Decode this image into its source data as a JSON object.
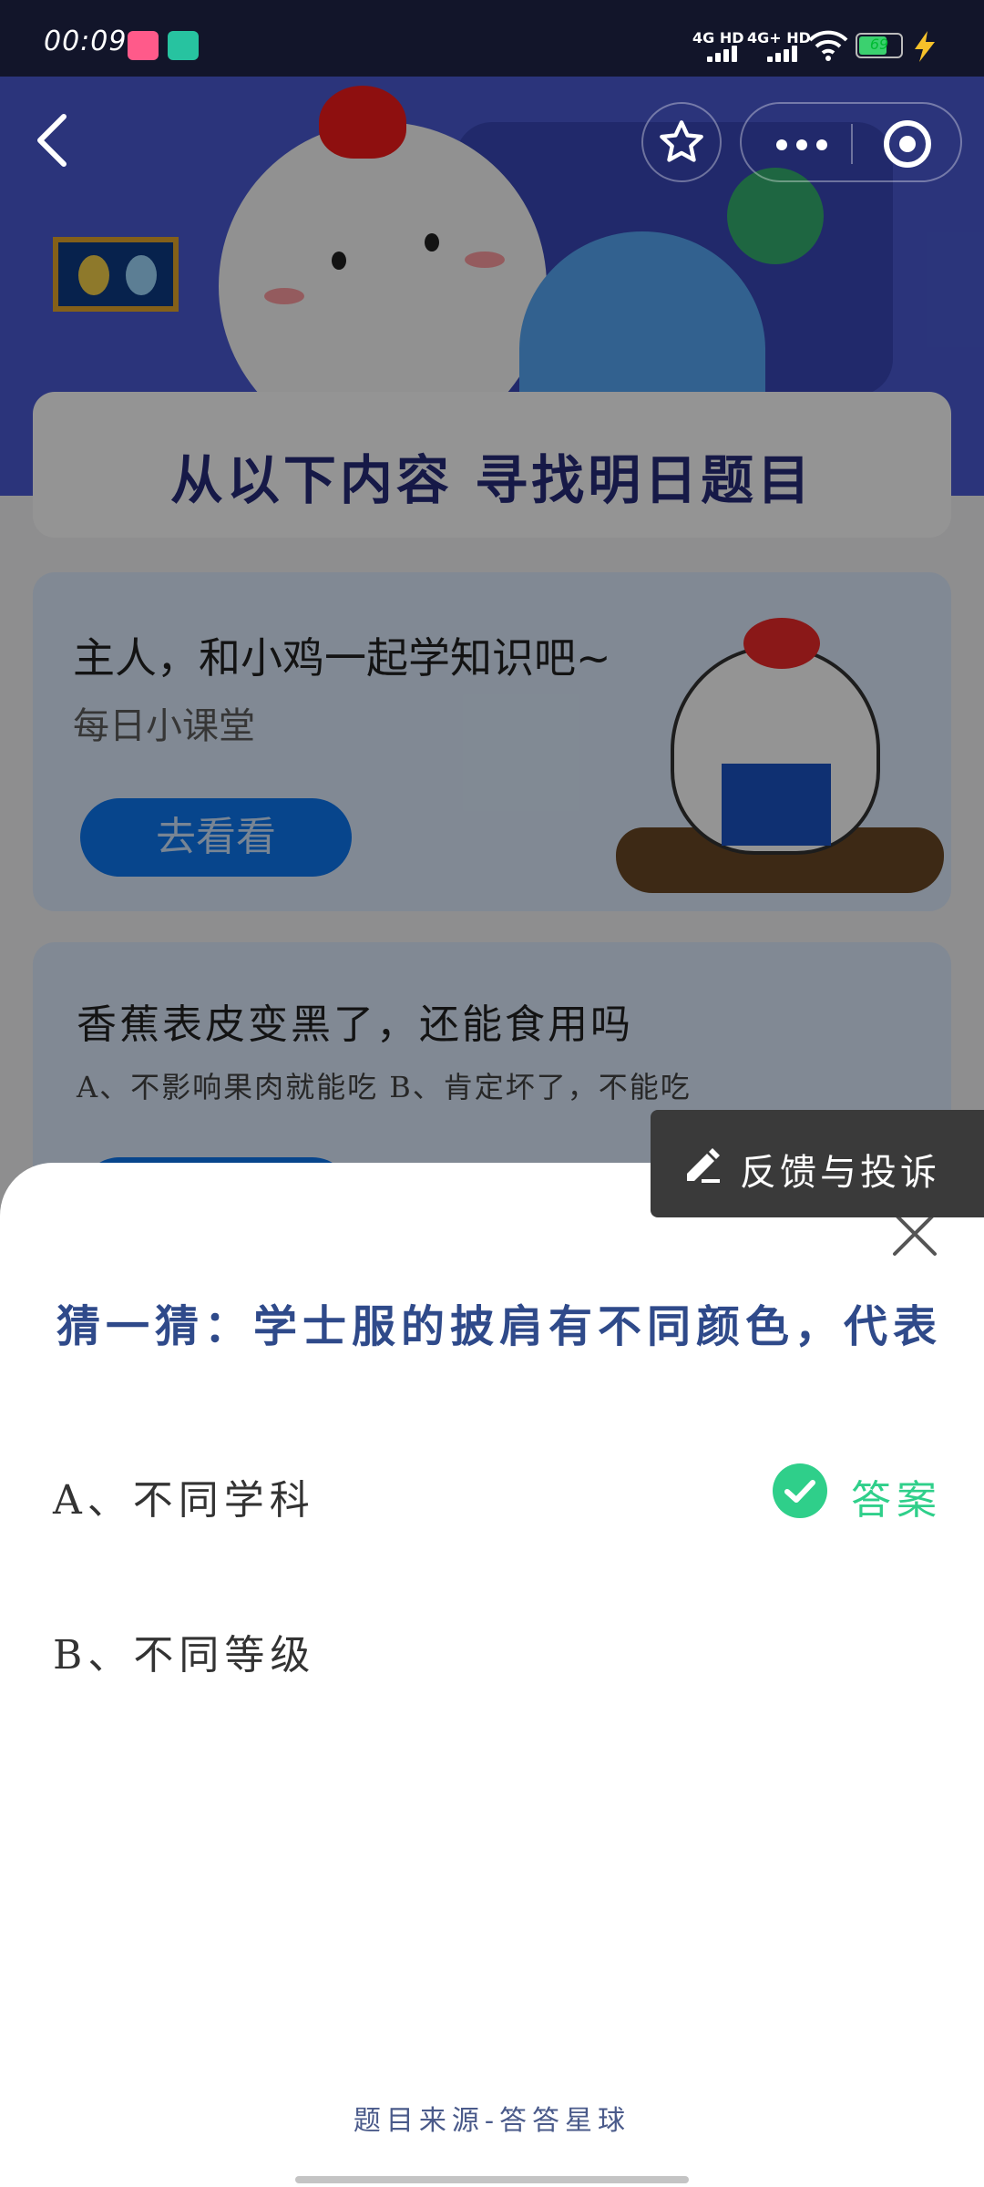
{
  "status_bar": {
    "time": "00:09",
    "network1": "4G HD",
    "network2": "4G+ HD",
    "battery": "69",
    "battery_level_percent": 69
  },
  "page": {
    "banner_title": "从以下内容  寻找明日题目",
    "card1": {
      "title": "主人，和小鸡一起学知识吧~",
      "subtitle": "每日小课堂",
      "button": "去看看"
    },
    "card2": {
      "question": "香蕉表皮变黑了，还能食用吗",
      "options": "A、不影响果肉就能吃    B、肯定坏了，不能吃"
    }
  },
  "feedback": {
    "label": "反馈与投诉",
    "icon": "pencil-icon"
  },
  "sheet": {
    "question": "猜一猜：学士服的披肩有不同颜色，代表",
    "options": [
      {
        "label": "A、不同学科",
        "is_answer": true
      },
      {
        "label": "B、不同等级",
        "is_answer": false
      }
    ],
    "answer_label": "答案",
    "source": "题目来源-答答星球"
  },
  "colors": {
    "accent_blue": "#0d77f2",
    "answer_green": "#2fcf8a",
    "question_blue": "#2f4a8a"
  }
}
